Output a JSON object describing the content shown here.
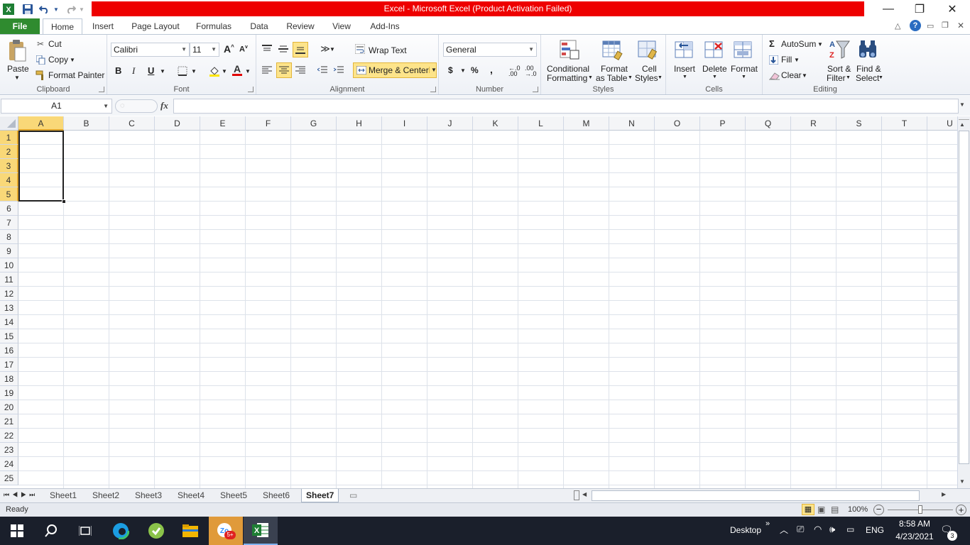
{
  "window": {
    "title": "Excel - Microsoft Excel (Product Activation Failed)"
  },
  "qat": {
    "icons": [
      "excel-logo-icon",
      "save-icon",
      "undo-icon",
      "redo-icon",
      "customize-qat-icon"
    ]
  },
  "tabs": {
    "file": "File",
    "items": [
      "Home",
      "Insert",
      "Page Layout",
      "Formulas",
      "Data",
      "Review",
      "View",
      "Add-Ins"
    ]
  },
  "ribbon": {
    "clipboard": {
      "label": "Clipboard",
      "paste": "Paste",
      "cut": "Cut",
      "copy": "Copy",
      "format_painter": "Format Painter"
    },
    "font": {
      "label": "Font",
      "family": "Calibri",
      "size": "11",
      "bold": "B",
      "italic": "I",
      "underline": "U"
    },
    "alignment": {
      "label": "Alignment",
      "wrap_text": "Wrap Text",
      "merge_center": "Merge & Center"
    },
    "number": {
      "label": "Number",
      "format": "General",
      "currency": "$",
      "percent": "%",
      "comma": ","
    },
    "styles": {
      "label": "Styles",
      "conditional_1": "Conditional",
      "conditional_2": "Formatting",
      "format_table_1": "Format",
      "format_table_2": "as Table",
      "cell_styles_1": "Cell",
      "cell_styles_2": "Styles"
    },
    "cells": {
      "label": "Cells",
      "insert": "Insert",
      "delete": "Delete",
      "format": "Format"
    },
    "editing": {
      "label": "Editing",
      "autosum": "AutoSum",
      "fill": "Fill",
      "clear": "Clear",
      "sort_1": "Sort &",
      "sort_2": "Filter",
      "find_1": "Find &",
      "find_2": "Select"
    }
  },
  "formula_bar": {
    "name_box": "A1",
    "fx": "fx",
    "value": ""
  },
  "grid": {
    "columns": [
      "A",
      "B",
      "C",
      "D",
      "E",
      "F",
      "G",
      "H",
      "I",
      "J",
      "K",
      "L",
      "M",
      "N",
      "O",
      "P",
      "Q",
      "R",
      "S",
      "T",
      "U"
    ],
    "rows": [
      "1",
      "2",
      "3",
      "4",
      "5",
      "6",
      "7",
      "8",
      "9",
      "10",
      "11",
      "12",
      "13",
      "14",
      "15",
      "16",
      "17",
      "18",
      "19",
      "20",
      "21",
      "22",
      "23",
      "24",
      "25"
    ],
    "selected_column": "A",
    "selected_rows": [
      "1",
      "2",
      "3",
      "4",
      "5"
    ]
  },
  "sheets": {
    "tabs": [
      "Sheet1",
      "Sheet2",
      "Sheet3",
      "Sheet4",
      "Sheet5",
      "Sheet6",
      "Sheet7"
    ],
    "active": "Sheet7"
  },
  "status": {
    "ready": "Ready",
    "zoom": "100%"
  },
  "taskbar": {
    "desktop": "Desktop",
    "lang": "ENG",
    "time": "8:58 AM",
    "date": "4/23/2021",
    "notifications": "3",
    "zoom_badge": "5+"
  },
  "colors": {
    "title_red": "#ee0000",
    "file_green": "#2f8b2f",
    "selection_gold": "#f9d878"
  }
}
